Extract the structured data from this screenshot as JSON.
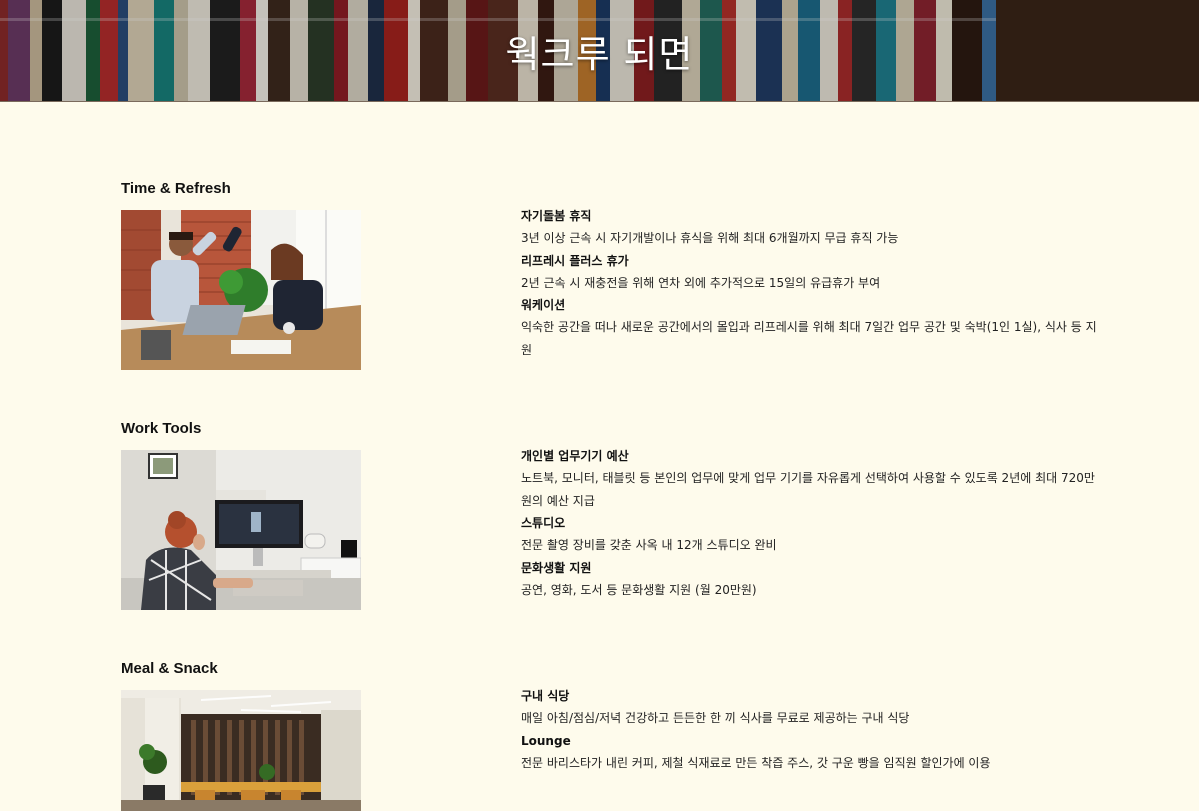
{
  "hero": {
    "title": "웍크루 되면"
  },
  "sections": [
    {
      "title": "Time & Refresh",
      "items": [
        {
          "title": "자기돌봄 휴직",
          "text": "3년 이상 근속 시 자기개발이나 휴식을 위해 최대 6개월까지 무급 휴직 가능"
        },
        {
          "title": "리프레시 플러스 휴가",
          "text": "2년 근속 시 재충전을 위해 연차 외에 추가적으로 15일의 유급휴가 부여"
        },
        {
          "title": "워케이션",
          "text": "익숙한 공간을 떠나 새로운 공간에서의 몰입과 리프레시를 위해 최대 7일간 업무 공간 및 숙박(1인 1실), 식사 등 지원"
        }
      ]
    },
    {
      "title": "Work Tools",
      "items": [
        {
          "title": "개인별 업무기기 예산",
          "text": "노트북, 모니터, 태블릿 등 본인의 업무에 맞게 업무 기기를 자유롭게 선택하여 사용할 수 있도록 2년에 최대 720만 원의 예산 지급"
        },
        {
          "title": "스튜디오",
          "text": "전문 촬영 장비를 갖춘 사옥 내 12개 스튜디오 완비"
        },
        {
          "title": "문화생활 지원",
          "text": "공연, 영화, 도서 등 문화생활 지원 (월 20만원)"
        }
      ]
    },
    {
      "title": "Meal & Snack",
      "items": [
        {
          "title": "구내 식당",
          "text": "매일 아침/점심/저녁 건강하고 든든한 한 끼 식사를 무료로 제공하는 구내 식당"
        },
        {
          "title": "Lounge",
          "text": "전문 바리스타가 내린 커피, 제철 식재료로 만든 착즙 주스, 갓 구운 빵을 임직원 할인가에 이용"
        }
      ]
    }
  ],
  "colors": {
    "page_background": "#fefbec",
    "text": "#111111",
    "hero_text": "#ffffff"
  }
}
